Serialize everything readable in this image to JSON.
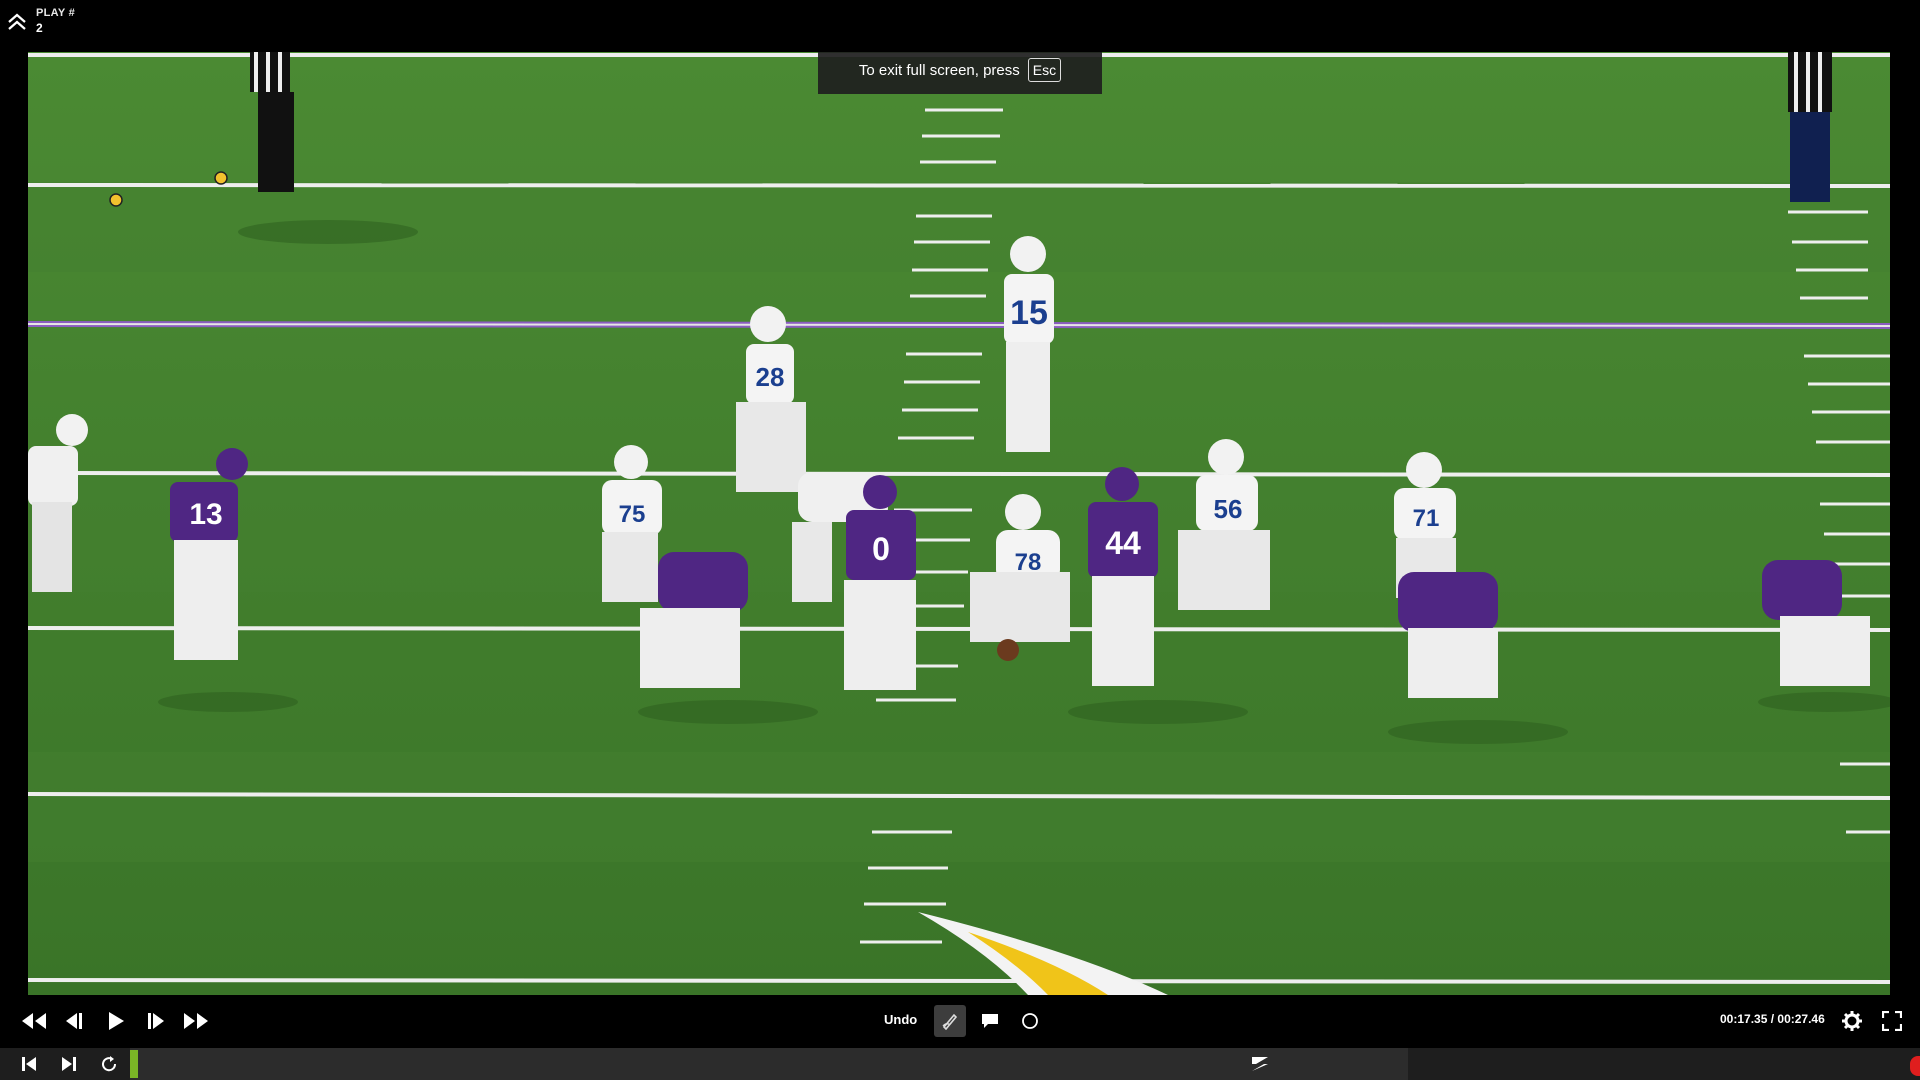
{
  "header": {
    "play_label": "PLAY #",
    "play_number": "2"
  },
  "fullscreen_notice": {
    "text": "To exit full screen, press",
    "key": "Esc"
  },
  "video": {
    "description_icon": "football-field-video",
    "jerseys": {
      "qb": "15",
      "rb": "28",
      "lb_left": "13",
      "dl_center": "0",
      "lb_center": "44",
      "og_right": "56",
      "og_left": "75",
      "c": "78",
      "ot_right": "71"
    }
  },
  "controls": {
    "undo_label": "Undo",
    "current_time": "00:17.35",
    "separator": " / ",
    "total_time": "00:27.46",
    "progress": 0.006
  },
  "colors": {
    "field": "#3f7a2c",
    "vikings": "#4f2683",
    "colts_blue": "#1b3f8f",
    "progress": "#7ab526",
    "rec": "#e01e1e"
  }
}
